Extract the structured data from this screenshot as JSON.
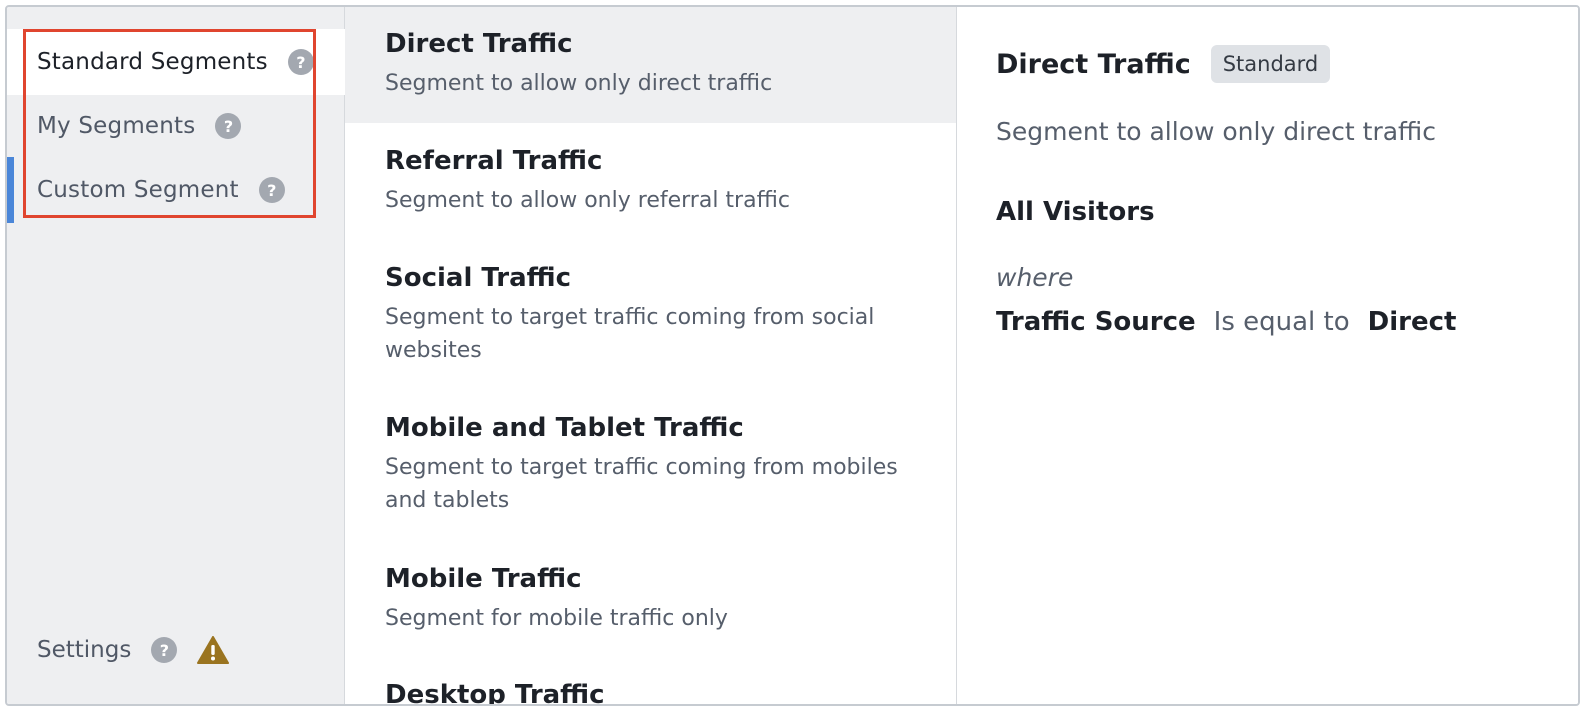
{
  "sidebar": {
    "items": [
      {
        "label": "Standard Segments",
        "help": "?"
      },
      {
        "label": "My Segments",
        "help": "?"
      },
      {
        "label": "Custom Segment",
        "help": "?"
      }
    ],
    "settings": {
      "label": "Settings",
      "help": "?"
    }
  },
  "segments": [
    {
      "title": "Direct Traffic",
      "desc": "Segment to allow only direct traffic"
    },
    {
      "title": "Referral Traffic",
      "desc": "Segment to allow only referral traffic"
    },
    {
      "title": "Social Traffic",
      "desc": "Segment to target traffic coming from social websites"
    },
    {
      "title": "Mobile and Tablet Traffic",
      "desc": "Segment to target traffic coming from mobiles and tablets"
    },
    {
      "title": "Mobile Traffic",
      "desc": "Segment for mobile traffic only"
    },
    {
      "title": "Desktop Traffic",
      "desc": ""
    }
  ],
  "detail": {
    "title": "Direct Traffic",
    "badge": "Standard",
    "description": "Segment to allow only direct traffic",
    "audience": "All Visitors",
    "where": "where",
    "rule": {
      "field": "Traffic Source",
      "operator": "Is equal to",
      "value": "Direct"
    }
  },
  "colors": {
    "accent": "#4a86d8",
    "highlight": "#e0452f",
    "warning": "#9a7420"
  }
}
